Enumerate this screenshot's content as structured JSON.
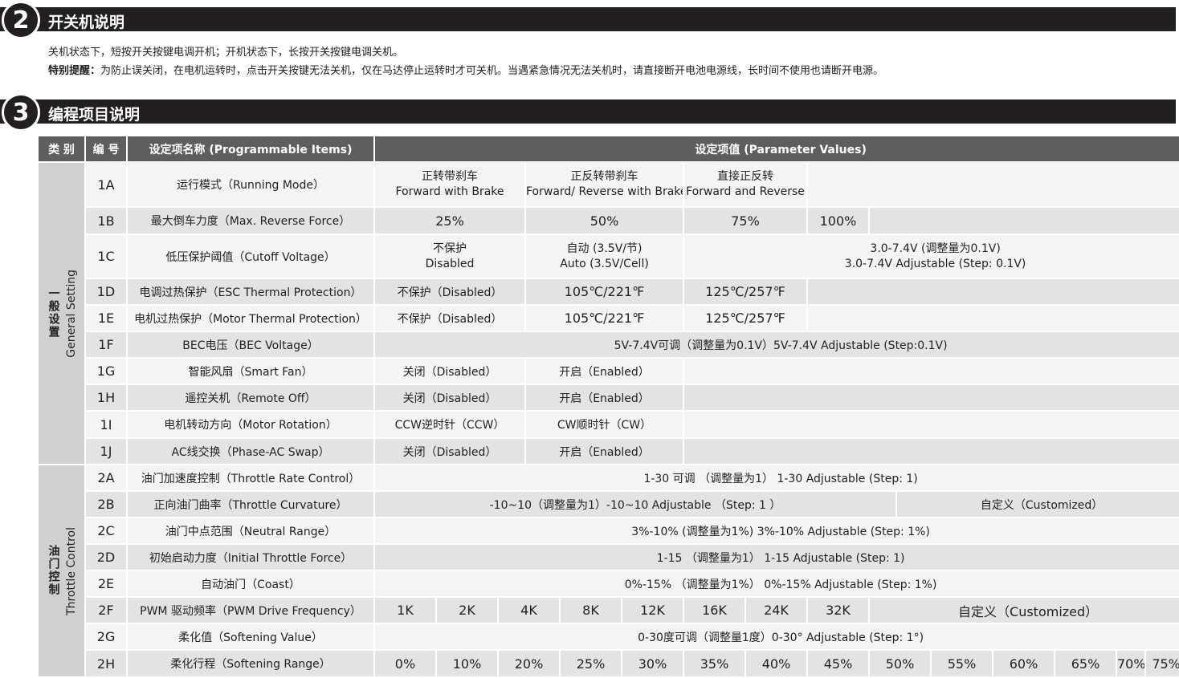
{
  "section2": {
    "number": "2",
    "title": "开关机说明",
    "line1": "关机状态下，短按开关按键电调开机；开机状态下，长按开关按键电调关机。",
    "note_label": "特别提醒：",
    "note_text": "为防止误关闭，在电机运转时，点击开关按键无法关机，仅在马达停止运转时才可关机。当遇紧急情况无法关机时，请直接断开电池电源线，长时间不使用也请断开电源。"
  },
  "section3": {
    "number": "3",
    "title": "编程项目说明"
  },
  "table": {
    "headers": {
      "category": "类 别",
      "number": "编 号",
      "name": "设定项名称 (Programmable Items)",
      "values": "设定项值 (Parameter Values)"
    },
    "categories": {
      "general_zh": "一般设置",
      "general_en": "General Setting",
      "throttle_zh": "油门控制",
      "throttle_en": "Throttle Control"
    },
    "rows": {
      "r1A": {
        "id": "1A",
        "name": "运行模式（Running Mode）",
        "v1a": "正转带刹车",
        "v1b": "Forward with Brake",
        "v2a": "正反转带刹车",
        "v2b": "Forward/ Reverse with Brake",
        "v3a": "直接正反转",
        "v3b": "Forward and Reverse"
      },
      "r1B": {
        "id": "1B",
        "name": "最大倒车力度（Max. Reverse Force）",
        "v1": "25%",
        "v2": "50%",
        "v3": "75%",
        "v4": "100%"
      },
      "r1C": {
        "id": "1C",
        "name": "低压保护阈值（Cutoff Voltage）",
        "v1a": "不保护",
        "v1b": "Disabled",
        "v2a": "自动 (3.5V/节)",
        "v2b": "Auto (3.5V/Cell)",
        "v3a": "3.0-7.4V (调整量为0.1V)",
        "v3b": "3.0-7.4V Adjustable (Step: 0.1V)"
      },
      "r1D": {
        "id": "1D",
        "name": "电调过热保护（ESC Thermal Protection）",
        "v1": "不保护（Disabled）",
        "v2": "105℃/221℉",
        "v3": "125℃/257℉"
      },
      "r1E": {
        "id": "1E",
        "name": "电机过热保护（Motor Thermal Protection）",
        "v1": "不保护（Disabled）",
        "v2": "105℃/221℉",
        "v3": "125℃/257℉"
      },
      "r1F": {
        "id": "1F",
        "name": "BEC电压（BEC Voltage）",
        "v1": "5V-7.4V可调（调整量为0.1V）5V-7.4V Adjustable (Step:0.1V)"
      },
      "r1G": {
        "id": "1G",
        "name": "智能风扇（Smart Fan）",
        "v1": "关闭（Disabled）",
        "v2": "开启（Enabled）"
      },
      "r1H": {
        "id": "1H",
        "name": "遥控关机（Remote Off）",
        "v1": "关闭（Disabled）",
        "v2": "开启（Enabled）"
      },
      "r1I": {
        "id": "1I",
        "name": "电机转动方向（Motor Rotation）",
        "v1": "CCW逆时针（CCW）",
        "v2": "CW顺时针（CW）"
      },
      "r1J": {
        "id": "1J",
        "name": "AC线交换（Phase-AC Swap）",
        "v1": "关闭（Disabled）",
        "v2": "开启（Enabled）"
      },
      "r2A": {
        "id": "2A",
        "name": "油门加速度控制（Throttle Rate Control）",
        "v1": "1-30 可调 （调整量为1） 1-30 Adjustable (Step: 1)"
      },
      "r2B": {
        "id": "2B",
        "name": "正向油门曲率（Throttle Curvature）",
        "v1": "-10~10（调整量为1）-10~10 Adjustable （Step: 1 ）",
        "v2": "自定义（Customized）"
      },
      "r2C": {
        "id": "2C",
        "name": "油门中点范围（Neutral Range）",
        "v1": "3%-10% (调整量为1%)  3%-10% Adjustable (Step: 1%)"
      },
      "r2D": {
        "id": "2D",
        "name": "初始启动力度（Initial Throttle Force）",
        "v1": "1-15 （调整量为1） 1-15 Adjustable (Step: 1)"
      },
      "r2E": {
        "id": "2E",
        "name": "自动油门（Coast）",
        "v1": "0%-15% （调整量为1%） 0%-15% Adjustable (Step: 1%)"
      },
      "r2F": {
        "id": "2F",
        "name": "PWM 驱动频率（PWM Drive Frequency）",
        "vals": [
          "1K",
          "2K",
          "4K",
          "8K",
          "12K",
          "16K",
          "24K",
          "32K"
        ],
        "custom": "自定义（Customized）"
      },
      "r2G": {
        "id": "2G",
        "name": "柔化值（Softening Value）",
        "v1": "0-30度可调（调整量1度）0-30° Adjustable (Step: 1°)"
      },
      "r2H": {
        "id": "2H",
        "name": "柔化行程（Softening Range）",
        "vals": [
          "0%",
          "10%",
          "20%",
          "25%",
          "30%",
          "35%",
          "40%",
          "45%",
          "50%",
          "55%",
          "60%",
          "65%",
          "70%",
          "75%"
        ]
      }
    }
  }
}
